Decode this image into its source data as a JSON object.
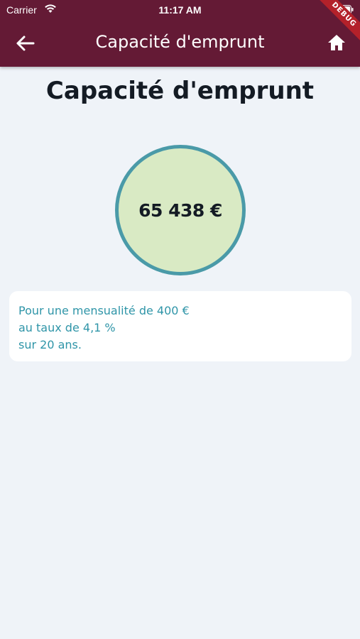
{
  "status_bar": {
    "carrier": "Carrier",
    "time": "11:17 AM"
  },
  "appbar": {
    "title": "Capacité d'emprunt",
    "back_icon": "arrow-left-icon",
    "home_icon": "home-icon",
    "debug_label": "DEBUG"
  },
  "page": {
    "title": "Capacité d'emprunt",
    "result": "65 438 €"
  },
  "info": {
    "line1": "Pour une mensualité de 400 €",
    "line2": "au taux de 4,1 %",
    "line3": "sur 20 ans."
  },
  "colors": {
    "header": "#641a35",
    "background": "#eff3f8",
    "circle_fill": "#d9eac4",
    "circle_border": "#4a9aa8",
    "info_text": "#2f95a8"
  }
}
